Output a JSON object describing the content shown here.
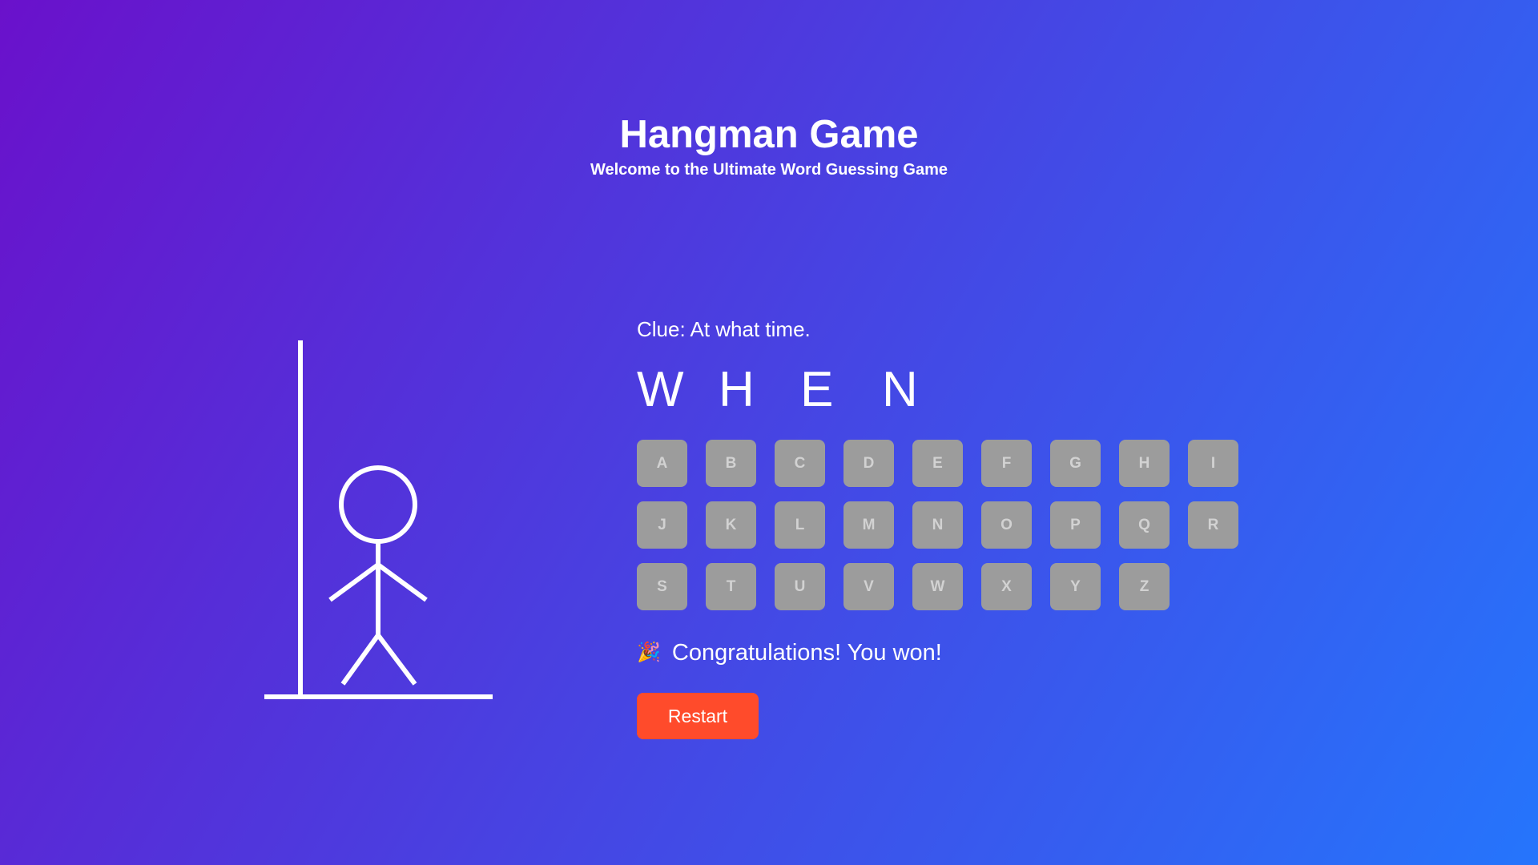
{
  "header": {
    "title": "Hangman Game",
    "subtitle": "Welcome to the Ultimate Word Guessing Game"
  },
  "game": {
    "clue": "Clue: At what time.",
    "word_letters": [
      "W",
      "H",
      "E",
      "N"
    ],
    "keyboard": [
      "A",
      "B",
      "C",
      "D",
      "E",
      "F",
      "G",
      "H",
      "I",
      "J",
      "K",
      "L",
      "M",
      "N",
      "O",
      "P",
      "Q",
      "R",
      "S",
      "T",
      "U",
      "V",
      "W",
      "X",
      "Y",
      "Z"
    ],
    "status_icon": "🎉",
    "status": "Congratulations! You won!",
    "restart_label": "Restart"
  },
  "colors": {
    "background_start": "#6a11cb",
    "background_end": "#2575fc",
    "key_disabled": "#9c9c9c",
    "restart": "#ff4b2b"
  }
}
